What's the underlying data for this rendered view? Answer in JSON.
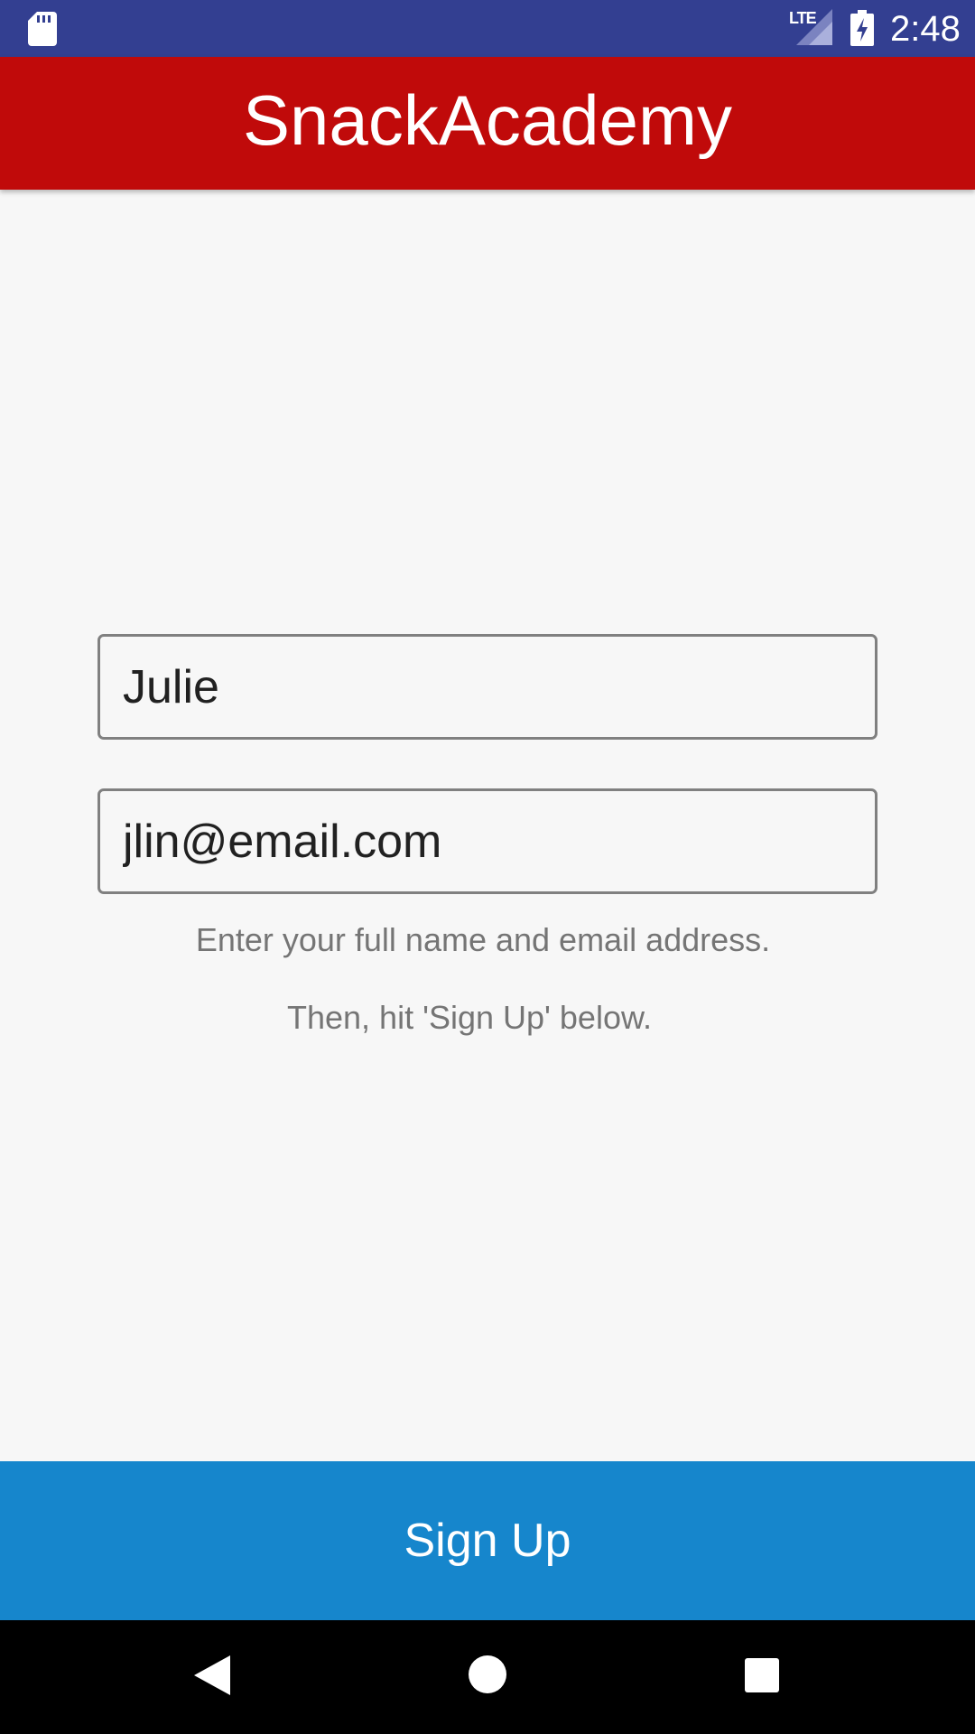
{
  "status_bar": {
    "time": "2:48",
    "network": "LTE",
    "icons": [
      "sd-card-icon",
      "lte-signal-icon",
      "battery-charging-icon"
    ],
    "background": "#333f91"
  },
  "app_bar": {
    "title": "SnackAcademy",
    "background": "#c00a0a"
  },
  "form": {
    "name_value": "Julie",
    "email_value": "jlin@email.com",
    "hint_line1": "Enter your full name and email address.",
    "hint_line2": "Then, hit 'Sign Up' below."
  },
  "signup_button": {
    "label": "Sign Up",
    "background": "#1686cc"
  },
  "nav_bar": {
    "icons": [
      "back-icon",
      "home-icon",
      "recents-icon"
    ]
  }
}
